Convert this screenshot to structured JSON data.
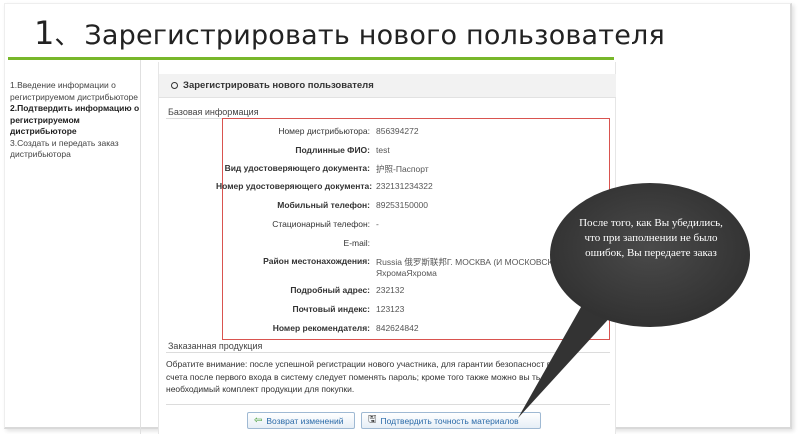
{
  "slide": {
    "number": "1",
    "separator": "、",
    "title": "Зарегистрировать нового пользователя"
  },
  "steps": [
    {
      "text": "1.Введение информации о регистрируемом дистрибьюторе",
      "active": false
    },
    {
      "text": "2.Подтвердить информацию о регистрируемом дистрибьюторе",
      "active": true
    },
    {
      "text": "3.Создать и передать заказ дистрибьютора",
      "active": false
    }
  ],
  "panel": {
    "title": "Зарегистрировать нового пользователя",
    "section_basic": "Базовая информация",
    "section_ordered": "Заказанная продукция",
    "fields": [
      {
        "label": "Номер дистрибьютора:",
        "value": "856394272",
        "bold": false
      },
      {
        "label": "Подлинные ФИО:",
        "value": "test",
        "bold": true
      },
      {
        "label": "Вид удостоверяющего документа:",
        "value": "护照-Паспорт",
        "bold": true
      },
      {
        "label": "Номер удостоверяющего документа:",
        "value": "232131234322",
        "bold": true
      },
      {
        "label": "Мобильный телефон:",
        "value": "89253150000",
        "bold": true
      },
      {
        "label": "Стационарный телефон:",
        "value": "-",
        "bold": false
      },
      {
        "label": "E-mail:",
        "value": "",
        "bold": false
      },
      {
        "label": "Район местонахождения:",
        "value": "Russia 俄罗斯联邦Г. МОСКВА (И МОСКОВСКА",
        "value2": "ЯхромаЯхрома",
        "bold": true
      },
      {
        "label": "Подробный адрес:",
        "value": "232132",
        "bold": true
      },
      {
        "label": "Почтовый индекс:",
        "value": "123123",
        "bold": true
      },
      {
        "label": "Номер рекомендателя:",
        "value": "842624842",
        "bold": true
      }
    ],
    "notice": "Обратите внимание: после успешной регистрации нового участника, для гарантии безопасности ... вого счета после первого входа в систему следует поменять пароль; кроме того также можно вы...ть необходимый комплект продукции для покупки.",
    "notice_lines": [
      "Обратите внимание: после успешной регистрации нового участника, для гарантии безопасност",
      "вого",
      "счета после первого входа в систему следует поменять пароль; кроме того также можно вы",
      "ть",
      "необходимый комплект продукции для покупки."
    ],
    "buttons": {
      "back": "Возврат изменений",
      "confirm": "Подтвердить точность материалов"
    }
  },
  "callout": {
    "text": "После того, как Вы убедились, что при заполнении не было ошибок, Вы передаете заказ",
    "color": "#3b3b3b"
  },
  "colors": {
    "accent_green": "#78b72a",
    "highlight_red": "#d9534f",
    "button_blue": "#2a6aa8"
  }
}
